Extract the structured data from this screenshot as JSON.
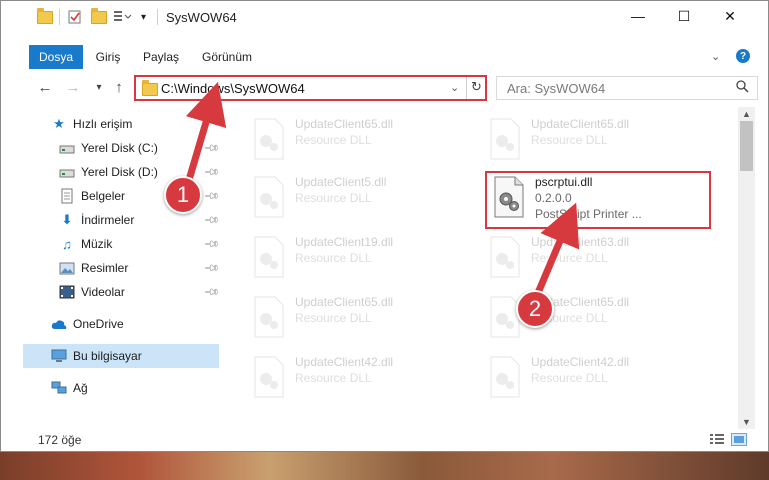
{
  "window": {
    "title": "SysWOW64",
    "controls": {
      "minimize": "—",
      "maximize": "☐",
      "close": "✕"
    }
  },
  "ribbon": {
    "tabs": [
      {
        "label": "Dosya",
        "active": true
      },
      {
        "label": "Giriş"
      },
      {
        "label": "Paylaş"
      },
      {
        "label": "Görünüm"
      }
    ],
    "collapse_icon": "chevron-up-icon",
    "help_icon": "help-icon"
  },
  "nav": {
    "back_icon": "arrow-left-icon",
    "forward_icon": "arrow-right-icon",
    "recent_icon": "chevron-down-icon",
    "up_icon": "arrow-up-icon",
    "address": "C:\\Windows\\SysWOW64",
    "search_placeholder": "Ara: SysWOW64"
  },
  "sidebar": {
    "quick_access": "Hızlı erişim",
    "items": [
      {
        "label": "Yerel Disk (C:)",
        "icon": "drive-icon",
        "pinned": true
      },
      {
        "label": "Yerel Disk (D:)",
        "icon": "drive-icon",
        "pinned": true
      },
      {
        "label": "Belgeler",
        "icon": "documents-icon",
        "pinned": true
      },
      {
        "label": "İndirmeler",
        "icon": "downloads-icon",
        "pinned": true
      },
      {
        "label": "Müzik",
        "icon": "music-icon",
        "pinned": true
      },
      {
        "label": "Resimler",
        "icon": "pictures-icon",
        "pinned": true
      },
      {
        "label": "Videolar",
        "icon": "videos-icon",
        "pinned": true
      }
    ],
    "onedrive": "OneDrive",
    "this_pc": "Bu bilgisayar",
    "network": "Ağ"
  },
  "files": [
    {
      "name": "UpdateClient65.dll",
      "sub1": "Resource DLL",
      "faded": true
    },
    {
      "name": "UpdateClient65.dll",
      "sub1": "Resource DLL",
      "faded": true
    },
    {
      "name": "UpdateClient5.dll",
      "sub1": "Resource DLL",
      "faded": true
    },
    {
      "name": "pscrptui.dll",
      "sub1": "0.2.0.0",
      "sub2": "PostScript Printer ...",
      "faded": false
    },
    {
      "name": "UpdateClient19.dll",
      "sub1": "Resource DLL",
      "faded": true
    },
    {
      "name": "UpdateClient63.dll",
      "sub1": "Resource DLL",
      "faded": true
    },
    {
      "name": "UpdateClient65.dll",
      "sub1": "Resource DLL",
      "faded": true
    },
    {
      "name": "UpdateClient65.dll",
      "sub1": "Resource DLL",
      "faded": true
    },
    {
      "name": "UpdateClient42.dll",
      "sub1": "Resource DLL",
      "faded": true
    },
    {
      "name": "UpdateClient42.dll",
      "sub1": "Resource DLL",
      "faded": true
    }
  ],
  "status": {
    "count": "172 öğe"
  },
  "callouts": [
    {
      "label": "1"
    },
    {
      "label": "2"
    }
  ],
  "colors": {
    "accent": "#1979ca",
    "highlight": "#d9363e",
    "selection": "#cce4f7"
  }
}
